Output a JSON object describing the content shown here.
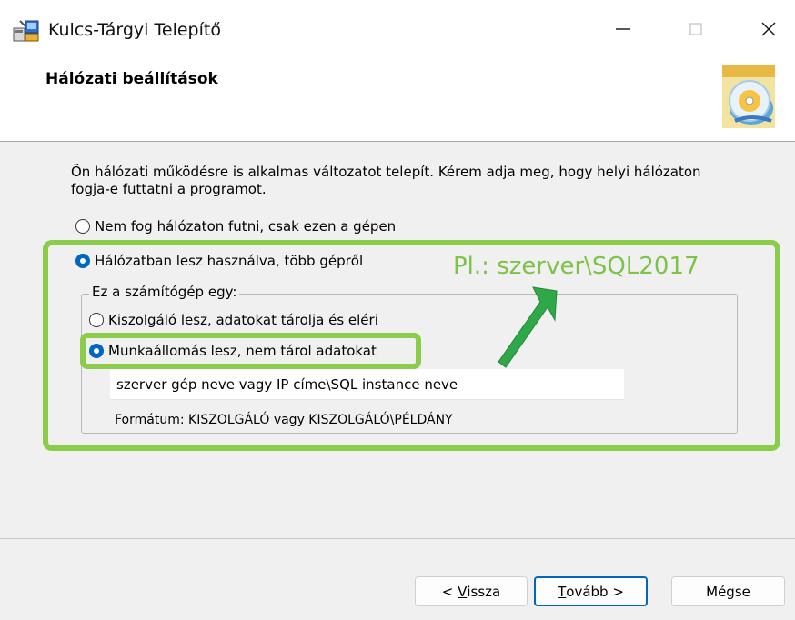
{
  "window": {
    "title": "Kulcs-Tárgyi Telepítő"
  },
  "header": {
    "title": "Hálózati beállítások"
  },
  "content": {
    "description": "Ön hálózati működésre is alkalmas változatot telepít. Kérem adja meg, hogy helyi hálózaton fogja-e futtatni a programot.",
    "options": [
      {
        "label": "Nem fog hálózaton futni, csak ezen a gépen",
        "checked": false
      },
      {
        "label": "Hálózatban lesz használva, több gépről",
        "checked": true
      }
    ],
    "group": {
      "legend": "Ez a számítógép egy:",
      "options": [
        {
          "label": "Kiszolgáló lesz, adatokat tárolja és eléri",
          "checked": false
        },
        {
          "label": "Munkaállomás lesz, nem tárol adatokat",
          "checked": true
        }
      ],
      "server_input_value": "szerver gép neve vagy IP címe\\SQL instance neve",
      "format_hint": "Formátum: KISZOLGÁLÓ vagy KISZOLGÁLÓ\\PÉLDÁNY"
    },
    "annotation": "Pl.: szerver\\SQL2017"
  },
  "buttons": {
    "back_prefix": "< ",
    "back_hotkey": "V",
    "back_rest": "issza",
    "next_hotkey": "T",
    "next_rest": "ovább >",
    "cancel": "Mégse"
  },
  "colors": {
    "accent": "#0067c0",
    "highlight": "#8bcc4a",
    "annotation": "#7ec24a"
  }
}
